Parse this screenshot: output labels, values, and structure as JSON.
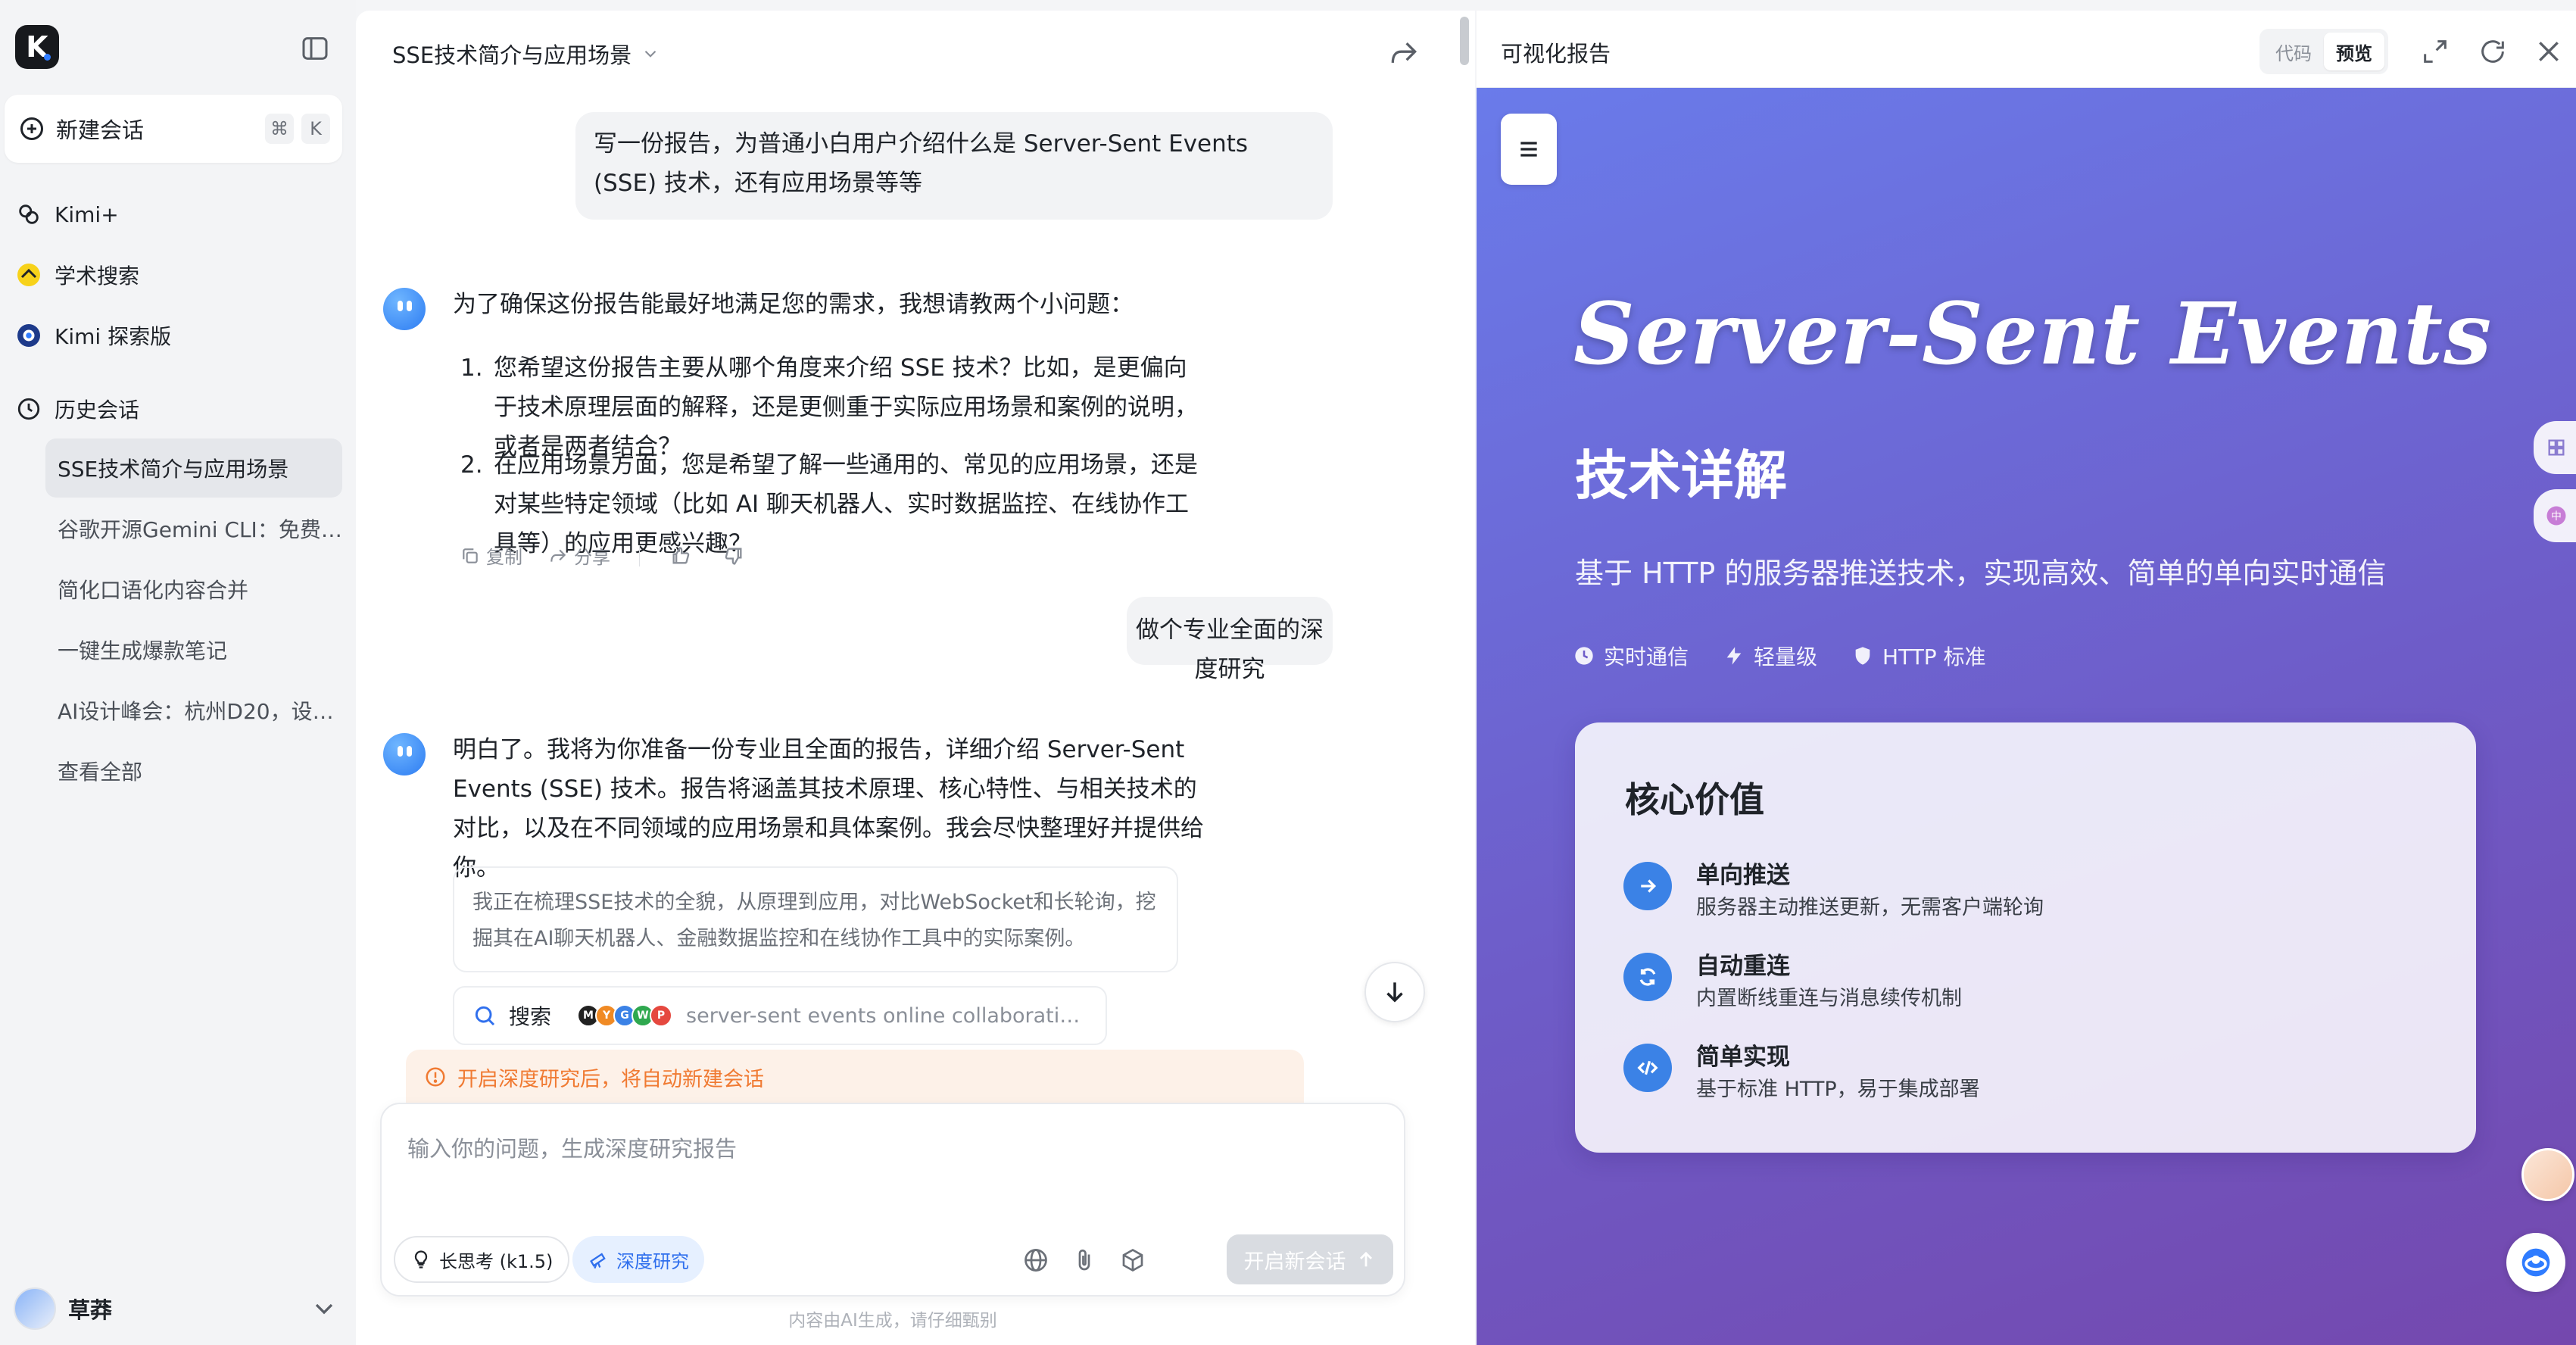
{
  "sidebar": {
    "logo": "K",
    "new_chat": {
      "label": "新建会话",
      "shortcut_mod": "⌘",
      "shortcut_key": "K"
    },
    "nav": [
      {
        "label": "Kimi+",
        "icon": "kimi-plus-icon"
      },
      {
        "label": "学术搜索",
        "icon": "academic-search-icon"
      },
      {
        "label": "Kimi 探索版",
        "icon": "explore-icon"
      }
    ],
    "history_label": "历史会话",
    "history": [
      "SSE技术简介与应用场景",
      "谷歌开源Gemini CLI：免费…",
      "简化口语化内容合并",
      "一键生成爆款笔记",
      "AI设计峰会：杭州D20，设…",
      "查看全部"
    ],
    "user": {
      "name": "草莽"
    }
  },
  "chat": {
    "title": "SSE技术简介与应用场景",
    "messages": {
      "user1": "写一份报告，为普通小白用户介绍什么是 Server-Sent Events (SSE) 技术，还有应用场景等等",
      "bot1_intro": "为了确保这份报告能最好地满足您的需求，我想请教两个小问题：",
      "bot1_q1_num": "1.",
      "bot1_q1": "您希望这份报告主要从哪个角度来介绍 SSE 技术？比如，是更偏向于技术原理层面的解释，还是更侧重于实际应用场景和案例的说明，或者是两者结合？",
      "bot1_q2_num": "2.",
      "bot1_q2": "在应用场景方面，您是希望了解一些通用的、常见的应用场景，还是对某些特定领域（比如 AI 聊天机器人、实时数据监控、在线协作工具等）的应用更感兴趣？",
      "user2": "做个专业全面的深度研究",
      "bot2": "明白了。我将为你准备一份专业且全面的报告，详细介绍 Server-Sent Events (SSE) 技术。报告将涵盖其技术原理、核心特性、与相关技术的对比，以及在不同领域的应用场景和具体案例。我会尽快整理好并提供给你。"
    },
    "actions": {
      "copy": "复制",
      "share": "分享"
    },
    "thinking": "我正在梳理SSE技术的全貌，从原理到应用，对比WebSocket和长轮询，挖掘其在AI聊天机器人、金融数据监控和在线协作工具中的实际案例。",
    "search": {
      "label": "搜索",
      "query": "server-sent events online collaborati…"
    },
    "notice": "开启深度研究后，将自动新建会话",
    "input_placeholder": "输入你的问题，生成深度研究报告",
    "chips": {
      "think": "长思考 (k1.5)",
      "deep": "深度研究"
    },
    "send": "开启新会话",
    "footer": "内容由AI生成，请仔细甄别"
  },
  "report": {
    "title": "可视化报告",
    "toggle": {
      "code": "代码",
      "preview": "预览"
    },
    "hero": {
      "title": "Server-Sent Events",
      "subtitle": "技术详解",
      "desc": "基于 HTTP 的服务器推送技术，实现高效、简单的单向实时通信",
      "tags": [
        "实时通信",
        "轻量级",
        "HTTP 标准"
      ]
    },
    "card": {
      "heading": "核心价值",
      "features": [
        {
          "title": "单向推送",
          "desc": "服务器主动推送更新，无需客户端轮询"
        },
        {
          "title": "自动重连",
          "desc": "内置断线重连与消息续传机制"
        },
        {
          "title": "简单实现",
          "desc": "基于标准 HTTP，易于集成部署"
        }
      ]
    }
  },
  "colors": {
    "accent": "#2f6fed",
    "notice": "#f07a32",
    "gradient_start": "#6a7bea",
    "gradient_end": "#7448ae",
    "feature_icon": "#3b82e6"
  }
}
